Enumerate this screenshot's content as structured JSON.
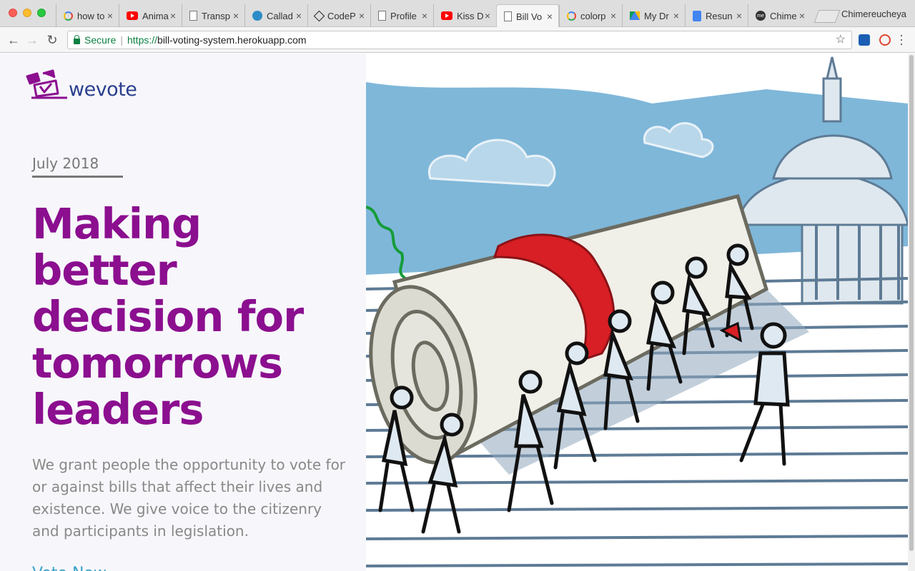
{
  "browser": {
    "tabs": [
      {
        "title": "how to",
        "favicon": "google-icon"
      },
      {
        "title": "Anima",
        "favicon": "youtube-icon"
      },
      {
        "title": "Transp",
        "favicon": "document-icon"
      },
      {
        "title": "Callad",
        "favicon": "callado-icon"
      },
      {
        "title": "CodeP",
        "favicon": "codepen-icon"
      },
      {
        "title": "Profile",
        "favicon": "document-icon"
      },
      {
        "title": "Kiss D",
        "favicon": "youtube-icon"
      },
      {
        "title": "Bill Vo",
        "favicon": "document-icon",
        "active": true
      },
      {
        "title": "colorp",
        "favicon": "google-icon"
      },
      {
        "title": "My Dr",
        "favicon": "google-drive-icon"
      },
      {
        "title": "Resun",
        "favicon": "google-docs-icon"
      },
      {
        "title": "Chime",
        "favicon": "me-icon"
      }
    ],
    "profile_name": "Chimereucheya",
    "security_label": "Secure",
    "url_scheme": "https://",
    "url_host": "bill-voting-system.herokuapp.com"
  },
  "page": {
    "logo_text": "wevote",
    "date": "July 2018",
    "headline": "Making better decision for tomorrows leaders",
    "blurb": "We grant people the opportunity to vote for or against bills that affect their lives and existence. We give voice to the citizenry and participants in legislation.",
    "cta_label": "Vote Now",
    "colors": {
      "headline": "#8b0f8f",
      "logo": "#2a3f8e",
      "sky": "#7fb7d9",
      "ribbon": "#d71f25",
      "cta": "#3aa3c7"
    },
    "hero_image": "illustration of people pushing a rolled-up bill up the Capitol steps"
  }
}
